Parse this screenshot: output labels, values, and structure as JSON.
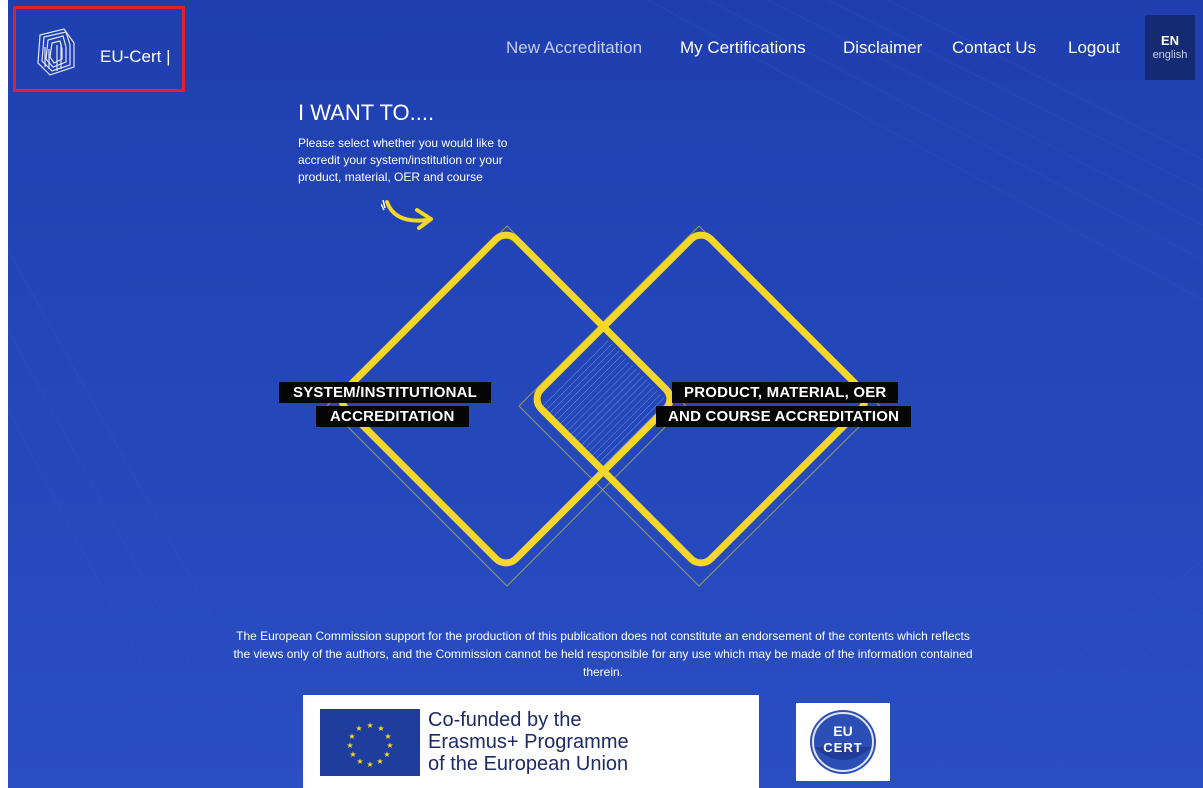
{
  "brand": {
    "name": "EU-Cert |"
  },
  "nav": {
    "items": [
      {
        "label": "New Accreditation",
        "active": true
      },
      {
        "label": "My Certifications"
      },
      {
        "label": "Disclaimer"
      },
      {
        "label": "Contact Us"
      },
      {
        "label": "Logout"
      }
    ]
  },
  "language": {
    "code": "EN",
    "name": "english"
  },
  "intro": {
    "title": "I WANT TO....",
    "lines": [
      "Please select whether you would like to",
      "accredit your system/institution or your",
      "product, material, OER and course"
    ]
  },
  "options": {
    "system": {
      "line1": "SYSTEM/INSTITUTIONAL",
      "line2": "ACCREDITATION"
    },
    "product": {
      "line1": "PRODUCT, MATERIAL, OER",
      "line2": "AND COURSE ACCREDITATION"
    }
  },
  "disclaimer": {
    "line1": "The European Commission support for the production of this publication does not constitute an endorsement of the contents which reflects",
    "line2": "the views only of the authors, and the Commission cannot be held responsible for any use which may be made of the information contained",
    "line3": "therein."
  },
  "footer": {
    "erasmus": {
      "line1": "Co-funded by the",
      "line2": "Erasmus+ Programme",
      "line3": "of the European Union"
    },
    "logo": {
      "top": "EU",
      "bottom": "CERT"
    }
  },
  "colors": {
    "background": "#2346b8",
    "diamond": "#f5d727",
    "highlight_box": "#e0202a",
    "label_bg": "#050505"
  }
}
